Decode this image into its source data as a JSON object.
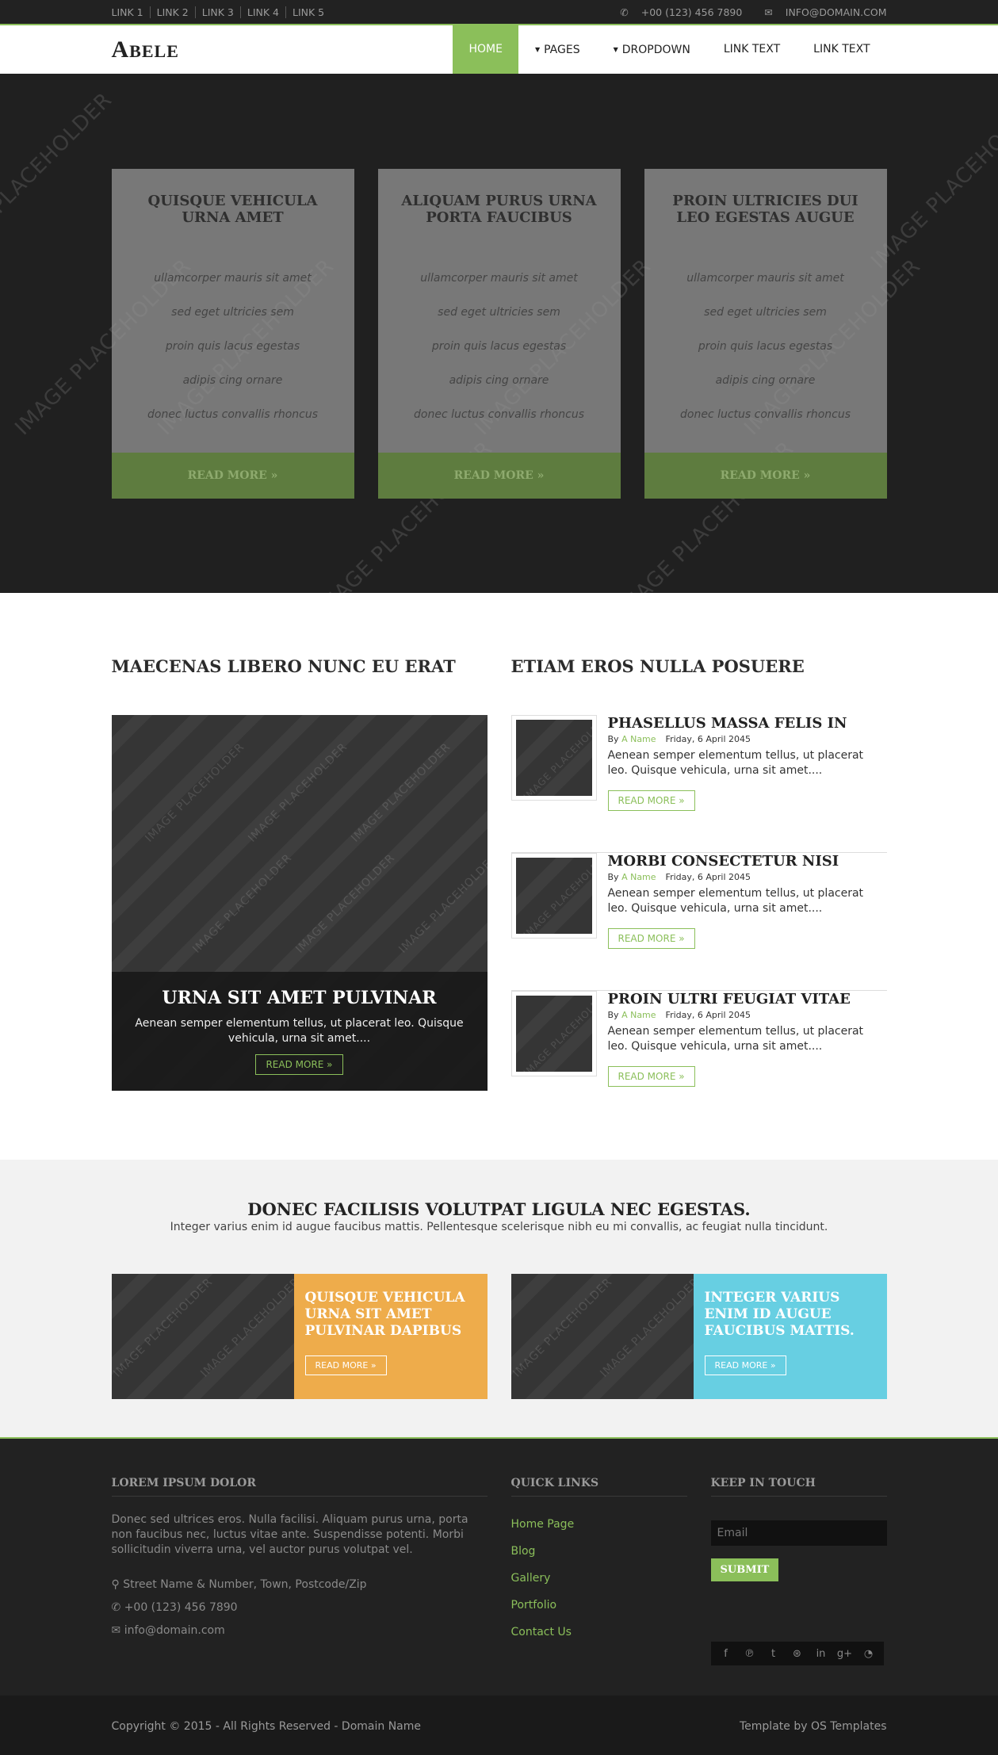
{
  "topbar": {
    "links": [
      "LINK 1",
      "LINK 2",
      "LINK 3",
      "LINK 4",
      "LINK 5"
    ],
    "phone": "+00 (123) 456 7890",
    "email": "INFO@DOMAIN.COM"
  },
  "header": {
    "logo_first": "A",
    "logo_rest": "BELE",
    "nav": [
      "HOME",
      "PAGES",
      "DROPDOWN",
      "LINK TEXT",
      "LINK TEXT"
    ]
  },
  "placeholder_text": "IMAGE PLACEHOLDER",
  "hero": {
    "cards": [
      {
        "title": "QUISQUE VEHICULA URNA AMET",
        "items": [
          "ullamcorper mauris sit amet",
          "sed eget ultricies sem",
          "proin quis lacus egestas",
          "adipis cing ornare",
          "donec luctus convallis rhoncus"
        ],
        "button": "READ MORE »"
      },
      {
        "title": "ALIQUAM PURUS URNA PORTA FAUCIBUS",
        "items": [
          "ullamcorper mauris sit amet",
          "sed eget ultricies sem",
          "proin quis lacus egestas",
          "adipis cing ornare",
          "donec luctus convallis rhoncus"
        ],
        "button": "READ MORE »"
      },
      {
        "title": "PROIN ULTRICIES DUI LEO EGESTAS AUGUE",
        "items": [
          "ullamcorper mauris sit amet",
          "sed eget ultricies sem",
          "proin quis lacus egestas",
          "adipis cing ornare",
          "donec luctus convallis rhoncus"
        ],
        "button": "READ MORE »"
      }
    ]
  },
  "news": {
    "left_title": "MAECENAS LIBERO NUNC EU ERAT",
    "right_title": "ETIAM EROS NULLA POSUERE",
    "feature": {
      "title": "URNA SIT AMET PULVINAR",
      "text": "Aenean semper elementum tellus, ut placerat leo. Quisque vehicula, urna sit amet....",
      "button": "READ MORE »"
    },
    "posts": [
      {
        "title": "PHASELLUS MASSA FELIS IN",
        "by": "By",
        "author": "A Name",
        "date": "Friday, 6 April 2045",
        "text": "Aenean semper elementum tellus, ut placerat leo. Quisque vehicula, urna sit amet....",
        "button": "READ MORE »"
      },
      {
        "title": "MORBI CONSECTETUR NISI",
        "by": "By",
        "author": "A Name",
        "date": "Friday, 6 April 2045",
        "text": "Aenean semper elementum tellus, ut placerat leo. Quisque vehicula, urna sit amet....",
        "button": "READ MORE »"
      },
      {
        "title": "PROIN ULTRI FEUGIAT VITAE",
        "by": "By",
        "author": "A Name",
        "date": "Friday, 6 April 2045",
        "text": "Aenean semper elementum tellus, ut placerat leo. Quisque vehicula, urna sit amet....",
        "button": "READ MORE »"
      }
    ]
  },
  "promo": {
    "title": "DONEC FACILISIS VOLUTPAT LIGULA NEC EGESTAS.",
    "subtitle": "Integer varius enim id augue faucibus mattis. Pellentesque scelerisque nibh eu mi convallis, ac feugiat nulla tincidunt.",
    "boxes": [
      {
        "title": "QUISQUE VEHICULA URNA SIT AMET PULVINAR DAPIBUS",
        "button": "READ MORE »",
        "color": "#eeac4b"
      },
      {
        "title": "INTEGER VARIUS ENIM ID AUGUE FAUCIBUS MATTIS.",
        "button": "READ MORE »",
        "color": "#67cfe2"
      }
    ]
  },
  "footer": {
    "about_title": "LOREM IPSUM DOLOR",
    "about_text": "Donec sed ultrices eros. Nulla facilisi. Aliquam purus urna, porta non faucibus nec, luctus vitae ante. Suspendisse potenti. Morbi sollicitudin viverra urna, vel auctor purus volutpat vel.",
    "address": "Street Name & Number, Town, Postcode/Zip",
    "phone": "+00 (123) 456 7890",
    "email": "info@domain.com",
    "links_title": "QUICK LINKS",
    "links": [
      "Home Page",
      "Blog",
      "Gallery",
      "Portfolio",
      "Contact Us"
    ],
    "touch_title": "KEEP IN TOUCH",
    "email_placeholder": "Email",
    "submit": "SUBMIT",
    "social_icons": [
      "facebook-icon",
      "pinterest-icon",
      "twitter-icon",
      "dribbble-icon",
      "linkedin-icon",
      "google-plus-icon",
      "rss-icon"
    ]
  },
  "copyright": {
    "left": "Copyright © 2015 - All Rights Reserved - Domain Name",
    "right": "Template by OS Templates"
  },
  "colors": {
    "accent": "#8bbf5a",
    "dark": "#222222",
    "orange": "#eeac4b",
    "cyan": "#67cfe2"
  }
}
